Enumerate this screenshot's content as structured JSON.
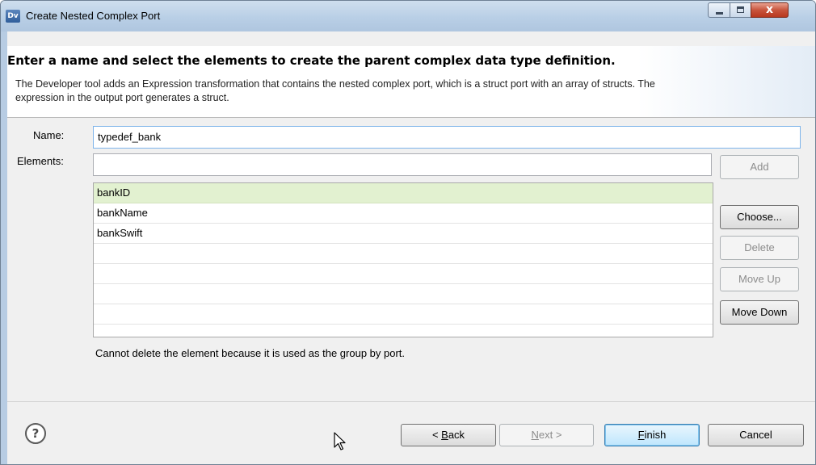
{
  "window": {
    "title": "Create Nested Complex Port",
    "app_icon_text": "Dv",
    "controls": {
      "minimize": "minimize",
      "maximize": "maximize",
      "close": "x"
    }
  },
  "header": {
    "title": "Enter a name and select the elements to create the parent complex data type definition.",
    "description": "The Developer tool adds an Expression transformation that contains the nested complex port, which is a struct port with an array of structs. The expression in the output port generates a struct."
  },
  "form": {
    "name_label": "Name:",
    "name_value": "typedef_bank",
    "elements_label": "Elements:",
    "elements_value": ""
  },
  "elements_list": {
    "rows": [
      "bankID",
      "bankName",
      "bankSwift",
      "",
      "",
      "",
      ""
    ],
    "selected_index": 0
  },
  "side_buttons": {
    "add": "Add",
    "choose": "Choose...",
    "delete": "Delete",
    "move_up": "Move Up",
    "move_down": "Move Down"
  },
  "status_message": "Cannot delete the element because it is used as the group by port.",
  "footer": {
    "help_glyph": "?",
    "back": {
      "prefix": "< ",
      "mnemonic": "B",
      "rest": "ack"
    },
    "next": {
      "mnemonic": "N",
      "rest": "ext >"
    },
    "finish": {
      "mnemonic": "F",
      "rest": "inish"
    },
    "cancel": "Cancel"
  },
  "colors": {
    "selected_row": "#e2f1d0",
    "title_bar": "#c3d6ea",
    "close_button": "#c8543c",
    "default_button_border": "#3c7fb1"
  }
}
